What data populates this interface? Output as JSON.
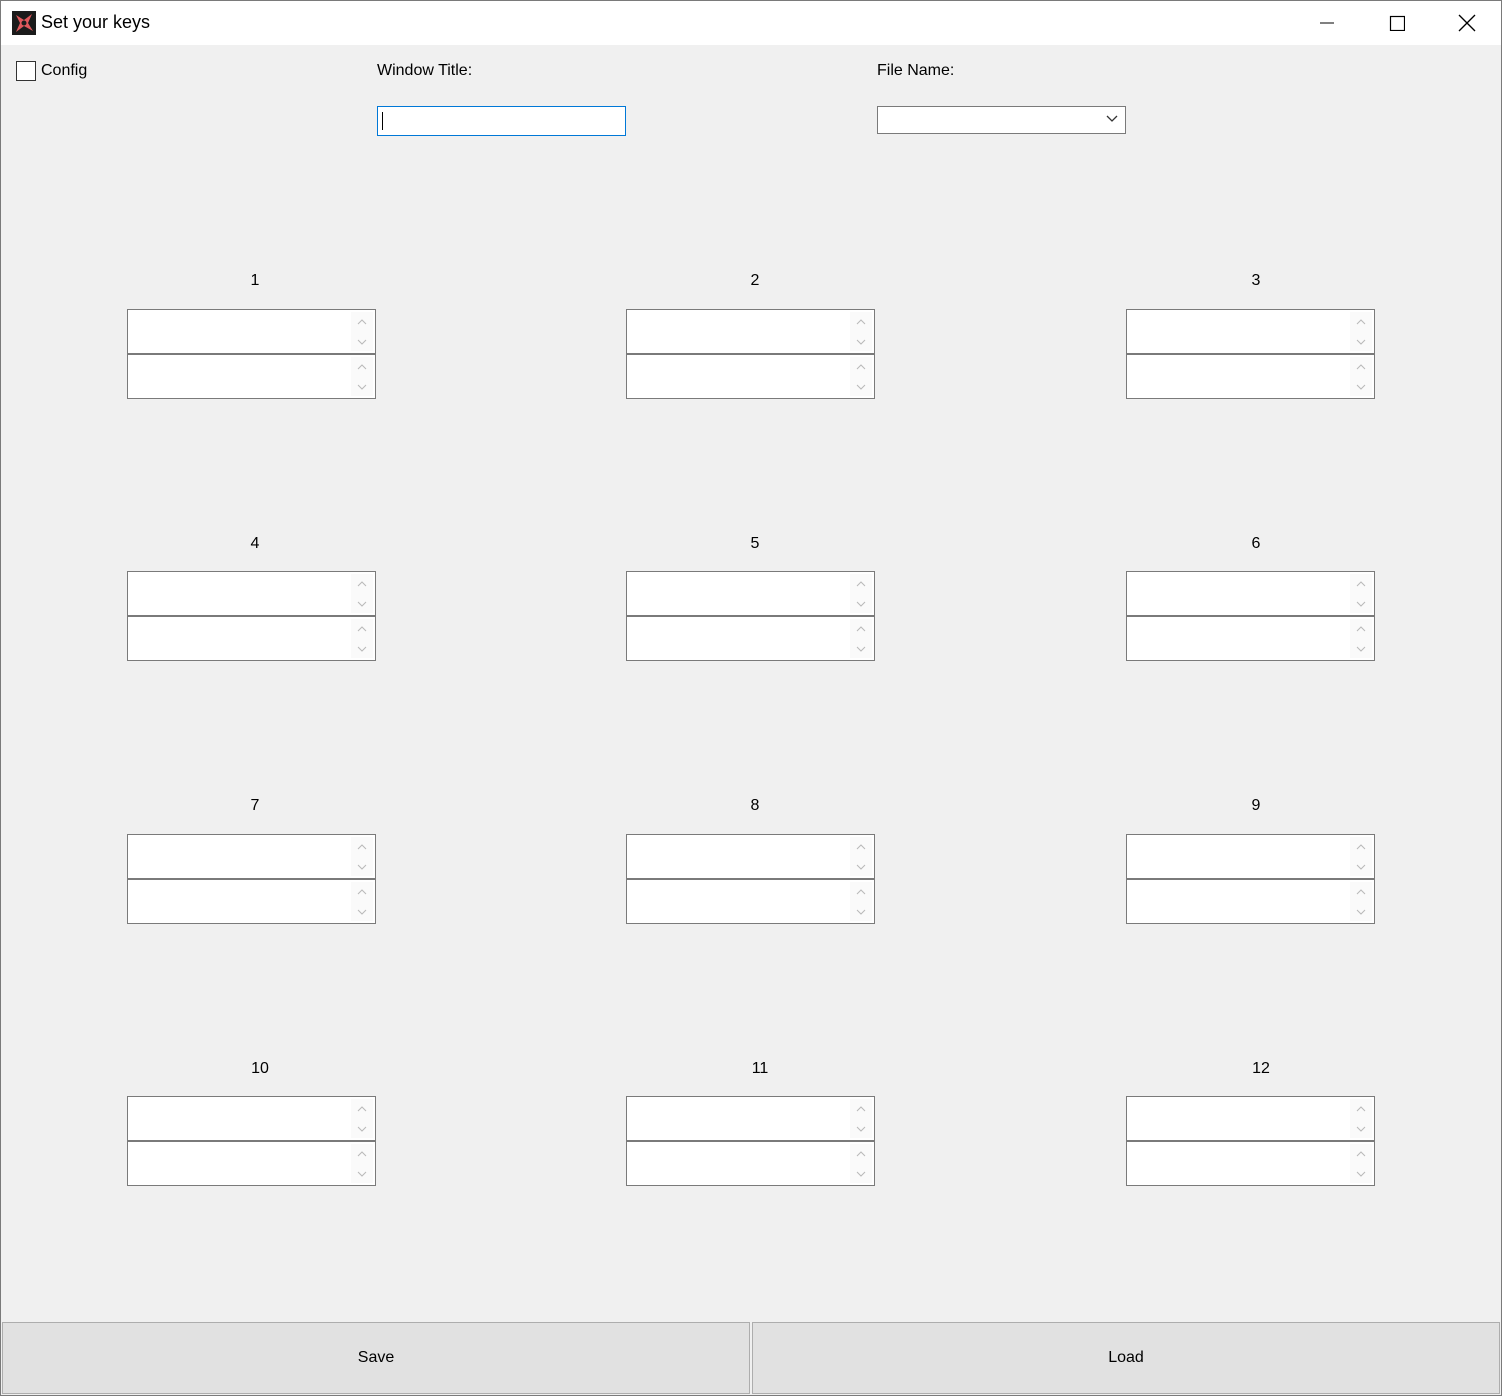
{
  "window": {
    "title": "Set your keys",
    "controls": [
      "minimize-icon",
      "maximize-icon",
      "close-icon"
    ]
  },
  "top_controls": {
    "config_label": "Config",
    "config_checked": false,
    "window_title_label": "Window Title:",
    "window_title_value": "",
    "file_name_label": "File Name:",
    "file_name_value": ""
  },
  "groups": [
    {
      "label": "1",
      "value1": "",
      "value2": ""
    },
    {
      "label": "2",
      "value1": "",
      "value2": ""
    },
    {
      "label": "3",
      "value1": "",
      "value2": ""
    },
    {
      "label": "4",
      "value1": "",
      "value2": ""
    },
    {
      "label": "5",
      "value1": "",
      "value2": ""
    },
    {
      "label": "6",
      "value1": "",
      "value2": ""
    },
    {
      "label": "7",
      "value1": "",
      "value2": ""
    },
    {
      "label": "8",
      "value1": "",
      "value2": ""
    },
    {
      "label": "9",
      "value1": "",
      "value2": ""
    },
    {
      "label": "10",
      "value1": "",
      "value2": ""
    },
    {
      "label": "11",
      "value1": "",
      "value2": ""
    },
    {
      "label": "12",
      "value1": "",
      "value2": ""
    }
  ],
  "buttons": {
    "save_label": "Save",
    "load_label": "Load"
  },
  "colors": {
    "window_bg": "#f0f0f0",
    "titlebar_bg": "#ffffff",
    "focus_border": "#0078d7",
    "button_bg": "#e1e1e1"
  }
}
